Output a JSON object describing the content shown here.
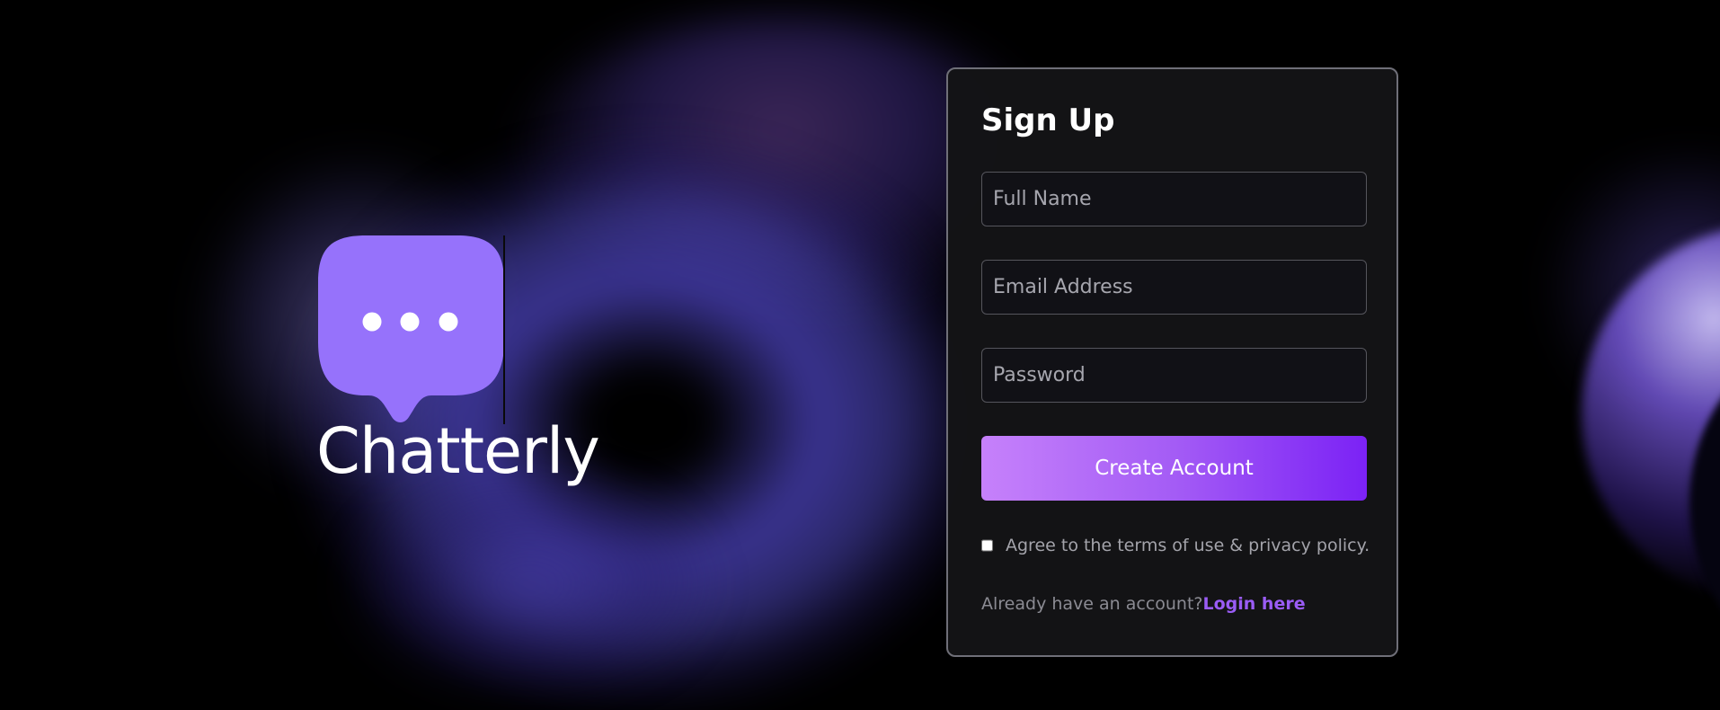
{
  "brand": {
    "name": "Chatterly",
    "icon": "chat-bubble-icon",
    "icon_color": "#9672fb"
  },
  "signup": {
    "title": "Sign Up",
    "fullname_placeholder": "Full Name",
    "email_placeholder": "Email Address",
    "password_placeholder": "Password",
    "submit_label": "Create Account",
    "terms_label": "Agree to the terms of use & privacy policy.",
    "login_prompt": "Already have an account?",
    "login_link": "Login here"
  },
  "colors": {
    "accent": "#9a5cf5",
    "button_gradient_start": "#c681fb",
    "button_gradient_end": "#7b22f5",
    "card_border": "#6f6f78",
    "card_background": "#141416"
  }
}
